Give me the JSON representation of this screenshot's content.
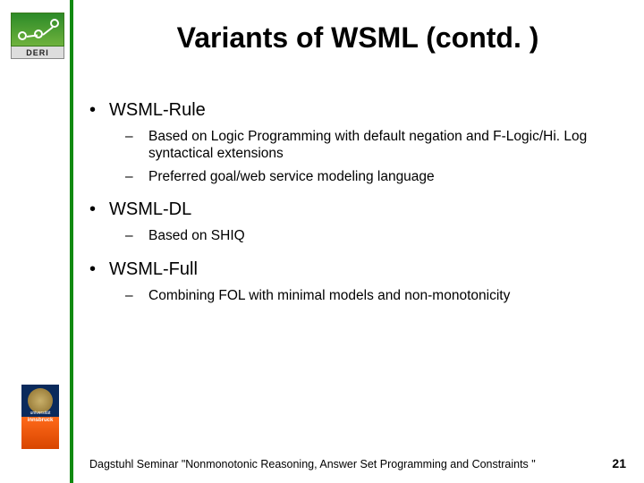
{
  "logo_text": "DERI",
  "uni_text_top": "universität",
  "uni_text_bot": "innsbruck",
  "title": "Variants of WSML (contd. )",
  "bullets": [
    {
      "label": "WSML-Rule",
      "subs": [
        "Based on Logic Programming with default negation and F-Logic/Hi. Log syntactical extensions",
        "Preferred goal/web service modeling language"
      ]
    },
    {
      "label": "WSML-DL",
      "subs": [
        "Based on SHIQ"
      ]
    },
    {
      "label": "WSML-Full",
      "subs": [
        "Combining FOL with minimal models and non-monotonicity"
      ]
    }
  ],
  "footer_text": "Dagstuhl Seminar \"Nonmonotonic Reasoning, Answer Set Programming and Constraints \"",
  "page_number": "21"
}
